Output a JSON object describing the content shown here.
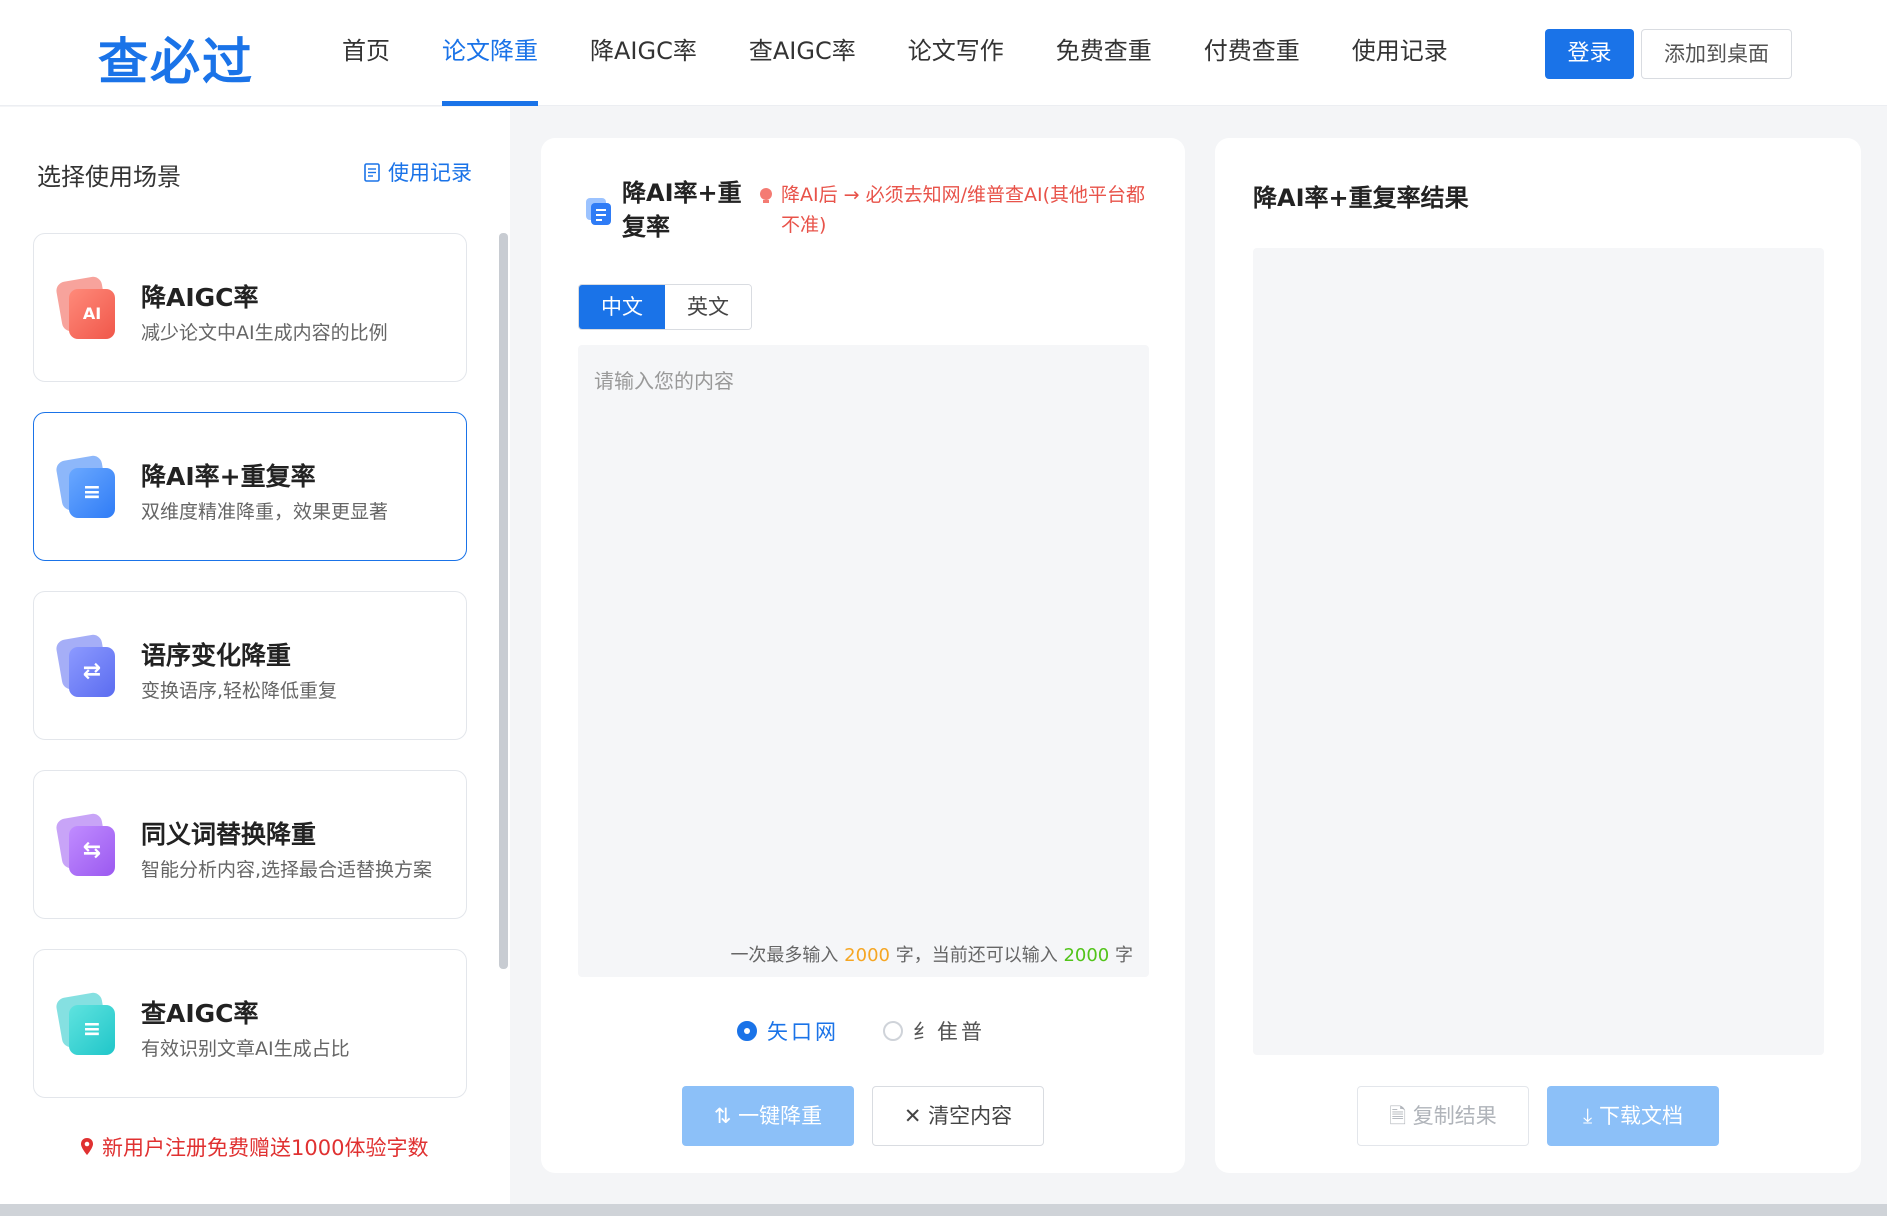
{
  "header": {
    "logo": "查必过",
    "nav": [
      "首页",
      "论文降重",
      "降AIGC率",
      "查AIGC率",
      "论文写作",
      "免费查重",
      "付费查重",
      "使用记录"
    ],
    "active_nav": "论文降重",
    "login_label": "登录",
    "add_desktop_label": "添加到桌面"
  },
  "sidebar": {
    "title": "选择使用场景",
    "history_label": "使用记录",
    "scenes": [
      {
        "title": "降AIGC率",
        "desc": "减少论文中AI生成内容的比例",
        "icon": "ai-doc-icon",
        "color": "#f0574a",
        "glyph": "AI"
      },
      {
        "title": "降AI率+重复率",
        "desc": "双维度精准降重，效果更显著",
        "icon": "doc-lines-icon",
        "color": "#2f7cf6",
        "glyph": "≡"
      },
      {
        "title": "语序变化降重",
        "desc": "变换语序,轻松降低重复",
        "icon": "swap-order-icon",
        "color": "#5b6cf0",
        "glyph": "⇄"
      },
      {
        "title": "同义词替换降重",
        "desc": "智能分析内容,选择最合适替换方案",
        "icon": "synonym-swap-icon",
        "color": "#9b59f0",
        "glyph": "⇆"
      },
      {
        "title": "查AIGC率",
        "desc": "有效识别文章AI生成占比",
        "icon": "detect-ai-icon",
        "color": "#20c6c9",
        "glyph": "≡"
      }
    ],
    "promo": "新用户注册免费赠送1000体验字数"
  },
  "editor": {
    "title": "降AI率+重复率",
    "notice": "降AI后 → 必须去知网/维普查AI(其他平台都不准)",
    "lang_tabs": [
      "中文",
      "英文"
    ],
    "active_lang": "中文",
    "placeholder": "请输入您的内容",
    "counter_prefix": "一次最多输入",
    "counter_max": "2000",
    "counter_mid": "字，当前还可以输入",
    "counter_left": "2000",
    "counter_suffix": "字",
    "platforms": [
      "矢口网",
      "纟隹普"
    ],
    "selected_platform": "矢口网",
    "reduce_label": "一键降重",
    "clear_label": "清空内容"
  },
  "result": {
    "title": "降AI率+重复率结果",
    "copy_label": "复制结果",
    "download_label": "下载文档"
  }
}
